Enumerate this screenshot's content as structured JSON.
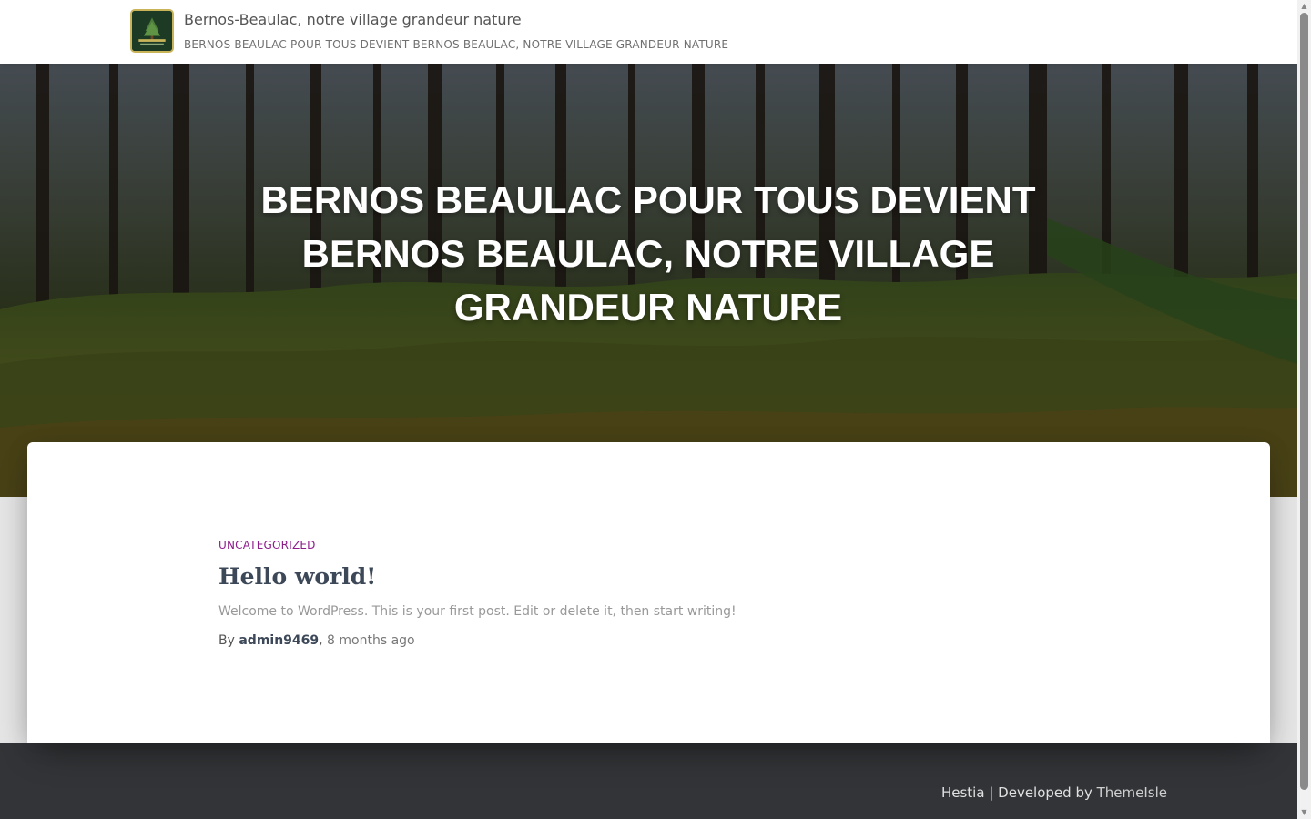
{
  "header": {
    "site_title": "Bernos-Beaulac, notre village grandeur nature",
    "site_description": "BERNOS BEAULAC POUR TOUS DEVIENT BERNOS BEAULAC, NOTRE VILLAGE GRANDEUR NATURE",
    "logo_icon": "village-logo-icon"
  },
  "hero": {
    "title": "BERNOS BEAULAC POUR TOUS DEVIENT BERNOS BEAULAC, NOTRE VILLAGE GRANDEUR NATURE",
    "background": "forest-ferns-image"
  },
  "post": {
    "category": "UNCATEGORIZED",
    "title": "Hello world!",
    "excerpt": "Welcome to WordPress. This is your first post. Edit or delete it, then start writing!",
    "by_label": "By",
    "author": "admin9469",
    "separator": ",",
    "date": "8 months ago"
  },
  "footer": {
    "theme_name": "Hestia",
    "divider": "|",
    "developed_by": "Developed by",
    "developer_link": "ThemeIsle"
  },
  "colors": {
    "category": "#8e1c8a",
    "title": "#3c4858",
    "footer_bg": "#323437",
    "page_bg": "#e5e5e5"
  }
}
